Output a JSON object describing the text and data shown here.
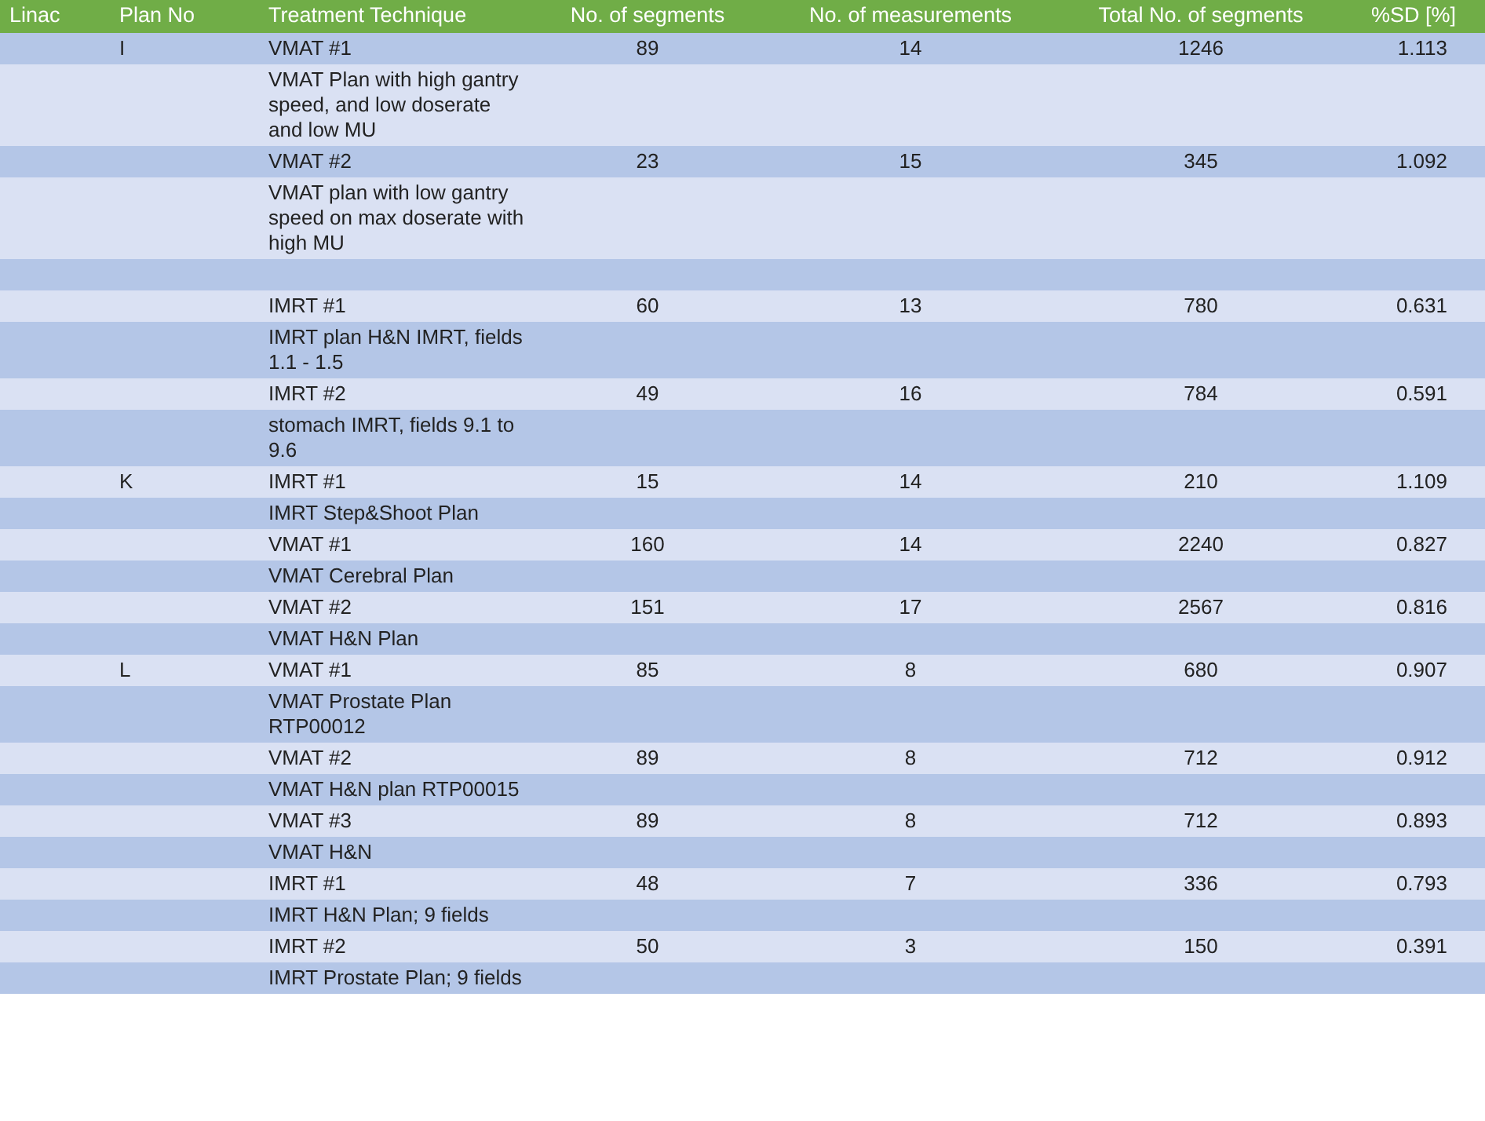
{
  "table": {
    "columns": [
      "Linac",
      "Plan No",
      "Treatment Technique",
      "No. of segments",
      "No. of measurements",
      "Total No. of segments",
      "%SD [%]"
    ],
    "rows": [
      {
        "kind": "data",
        "plan_no": "I",
        "technique": "VMAT #1",
        "segments": "89",
        "measurements": "14",
        "total_segments": "1246",
        "sd": "1.113"
      },
      {
        "kind": "note",
        "text": "VMAT Plan with high gantry speed, and low doserate and low MU"
      },
      {
        "kind": "data",
        "technique": "VMAT #2",
        "segments": "23",
        "measurements": "15",
        "total_segments": "345",
        "sd": "1.092"
      },
      {
        "kind": "note",
        "text": "VMAT plan with low gantry speed on max doserate with high MU"
      },
      {
        "kind": "blank"
      },
      {
        "kind": "data",
        "technique": "IMRT #1",
        "segments": "60",
        "measurements": "13",
        "total_segments": "780",
        "sd": "0.631"
      },
      {
        "kind": "note",
        "text": "IMRT plan H&N IMRT, fields 1.1 - 1.5"
      },
      {
        "kind": "data",
        "technique": "IMRT #2",
        "segments": "49",
        "measurements": "16",
        "total_segments": "784",
        "sd": "0.591"
      },
      {
        "kind": "note",
        "text": "stomach IMRT, fields 9.1 to 9.6"
      },
      {
        "kind": "data",
        "plan_no": "K",
        "technique": "IMRT #1",
        "segments": "15",
        "measurements": "14",
        "total_segments": "210",
        "sd": "1.109"
      },
      {
        "kind": "note",
        "text": "IMRT Step&Shoot Plan"
      },
      {
        "kind": "data",
        "technique": "VMAT #1",
        "segments": "160",
        "measurements": "14",
        "total_segments": "2240",
        "sd": "0.827"
      },
      {
        "kind": "note",
        "text": "VMAT Cerebral Plan"
      },
      {
        "kind": "data",
        "technique": "VMAT #2",
        "segments": "151",
        "measurements": "17",
        "total_segments": "2567",
        "sd": "0.816"
      },
      {
        "kind": "note",
        "text": "VMAT H&N Plan"
      },
      {
        "kind": "data",
        "plan_no": "L",
        "technique": "VMAT #1",
        "segments": "85",
        "measurements": "8",
        "total_segments": "680",
        "sd": "0.907"
      },
      {
        "kind": "note",
        "text": "VMAT Prostate Plan RTP00012"
      },
      {
        "kind": "data",
        "technique": "VMAT #2",
        "segments": "89",
        "measurements": "8",
        "total_segments": "712",
        "sd": "0.912"
      },
      {
        "kind": "note",
        "text": "VMAT H&N plan RTP00015"
      },
      {
        "kind": "data",
        "technique": "VMAT #3",
        "segments": "89",
        "measurements": "8",
        "total_segments": "712",
        "sd": "0.893"
      },
      {
        "kind": "note",
        "text": "VMAT H&N"
      },
      {
        "kind": "data",
        "technique": "IMRT #1",
        "segments": "48",
        "measurements": "7",
        "total_segments": "336",
        "sd": "0.793"
      },
      {
        "kind": "note",
        "text": "IMRT H&N Plan; 9 fields"
      },
      {
        "kind": "data",
        "technique": "IMRT #2",
        "segments": "50",
        "measurements": "3",
        "total_segments": "150",
        "sd": "0.391"
      },
      {
        "kind": "note",
        "text": "IMRT Prostate Plan; 9 fields"
      }
    ]
  }
}
